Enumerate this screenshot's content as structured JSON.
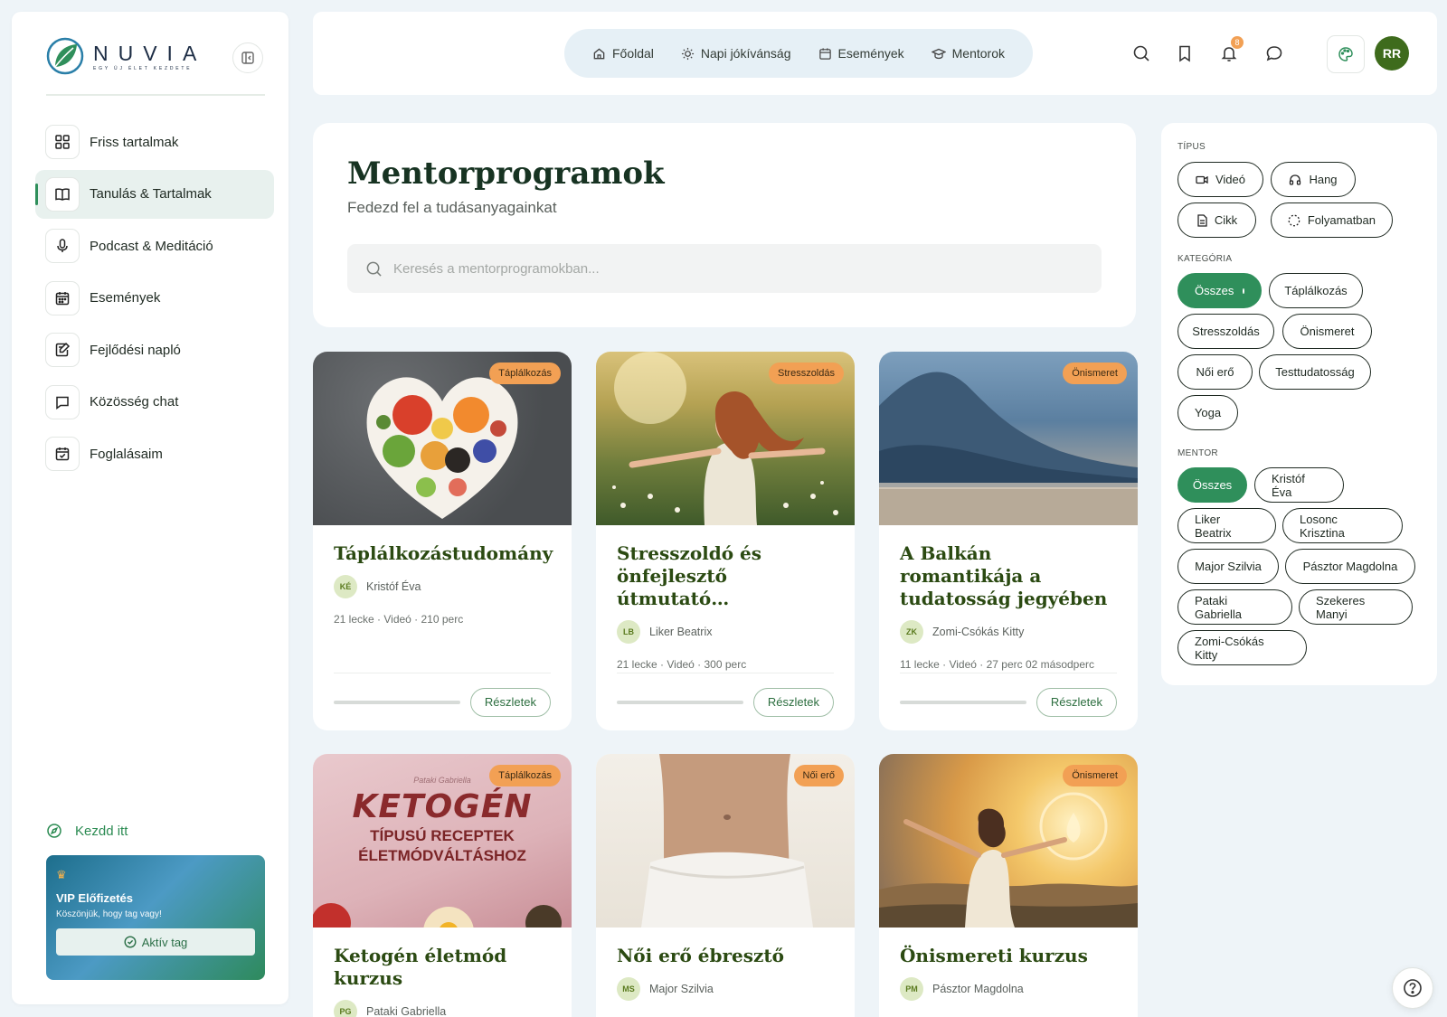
{
  "brand": {
    "name": "NUVIA",
    "tagline": "EGY ÚJ ÉLET KEZDETE"
  },
  "sidebar": {
    "items": [
      {
        "label": "Friss tartalmak",
        "icon": "grid-icon"
      },
      {
        "label": "Tanulás & Tartalmak",
        "icon": "book-open-icon",
        "active": true
      },
      {
        "label": "Podcast & Meditáció",
        "icon": "microphone-icon"
      },
      {
        "label": "Események",
        "icon": "calendar-icon"
      },
      {
        "label": "Fejlődési napló",
        "icon": "journal-edit-icon"
      },
      {
        "label": "Közösség chat",
        "icon": "chat-icon"
      },
      {
        "label": "Foglalásaim",
        "icon": "calendar-check-icon"
      }
    ],
    "start_label": "Kezdd itt",
    "vip": {
      "title": "VIP Előfizetés",
      "subtitle": "Köszönjük, hogy tag vagy!",
      "button": "Aktív tag"
    }
  },
  "topnav": {
    "items": [
      {
        "label": "Főoldal",
        "icon": "home-icon"
      },
      {
        "label": "Napi jókívánság",
        "icon": "sun-icon"
      },
      {
        "label": "Események",
        "icon": "calendar-icon"
      },
      {
        "label": "Mentorok",
        "icon": "graduation-cap-icon"
      }
    ],
    "notification_count": "8",
    "user_initials": "RR"
  },
  "hero": {
    "title": "Mentorprogramok",
    "subtitle": "Fedezd fel a tudásanyagainkat",
    "search_placeholder": "Keresés a mentorprogramokban..."
  },
  "cards": [
    {
      "title": "Táplálkozástudomány",
      "badge": "Táplálkozás",
      "mentor": "Kristóf Éva",
      "initials": "KÉ",
      "meta": "21 lecke · Videó · 210 perc",
      "progress": 0,
      "button": "Részletek"
    },
    {
      "title": "Stresszoldó és önfejlesztő útmutató…",
      "badge": "Stresszoldás",
      "mentor": "Liker Beatrix",
      "initials": "LB",
      "meta": "21 lecke · Videó · 300 perc",
      "progress": 0,
      "button": "Részletek"
    },
    {
      "title": "A Balkán romantikája a tudatosság jegyében",
      "badge": "Önismeret",
      "mentor": "Zomi-Csókás Kitty",
      "initials": "ZK",
      "meta": "11 lecke · Videó · 27 perc 02 másodperc",
      "progress": 0,
      "button": "Részletek"
    },
    {
      "title": "Ketogén életmód kurzus",
      "badge": "Táplálkozás",
      "mentor": "Pataki Gabriella",
      "initials": "PG",
      "image_text": {
        "small": "Pataki Gabriella",
        "big": "KETOGÉN",
        "line2": "TÍPUSÚ RECEPTEK",
        "line3": "ÉLETMÓDVÁLTÁSHOZ"
      }
    },
    {
      "title": "Női erő ébresztő",
      "badge": "Női erő",
      "mentor": "Major Szilvia",
      "initials": "MS"
    },
    {
      "title": "Önismereti kurzus",
      "badge": "Önismeret",
      "mentor": "Pásztor Magdolna",
      "initials": "PM"
    }
  ],
  "filters": {
    "type_label": "TÍPUS",
    "types": [
      {
        "label": "Videó",
        "icon": "video-icon"
      },
      {
        "label": "Hang",
        "icon": "headphones-icon"
      },
      {
        "label": "Cikk",
        "icon": "document-icon"
      },
      {
        "label": "Folyamatban",
        "icon": "progress-circle-icon"
      }
    ],
    "category_label": "KATEGÓRIA",
    "categories": [
      "Összes",
      "Táplálkozás",
      "Stresszoldás",
      "Önismeret",
      "Női erő",
      "Testtudatosság",
      "Yoga"
    ],
    "mentor_label": "MENTOR",
    "mentors": [
      "Összes",
      "Kristóf Éva",
      "Liker Beatrix",
      "Losonc Krisztina",
      "Major Szilvia",
      "Pásztor Magdolna",
      "Pataki Gabriella",
      "Szekeres Manyi",
      "Zomi-Csókás Kitty"
    ]
  },
  "colors": {
    "accent": "#2f8f5b",
    "badge": "#f2a054",
    "card_title": "#2b4a12",
    "avatar": "#3e6b1c"
  }
}
